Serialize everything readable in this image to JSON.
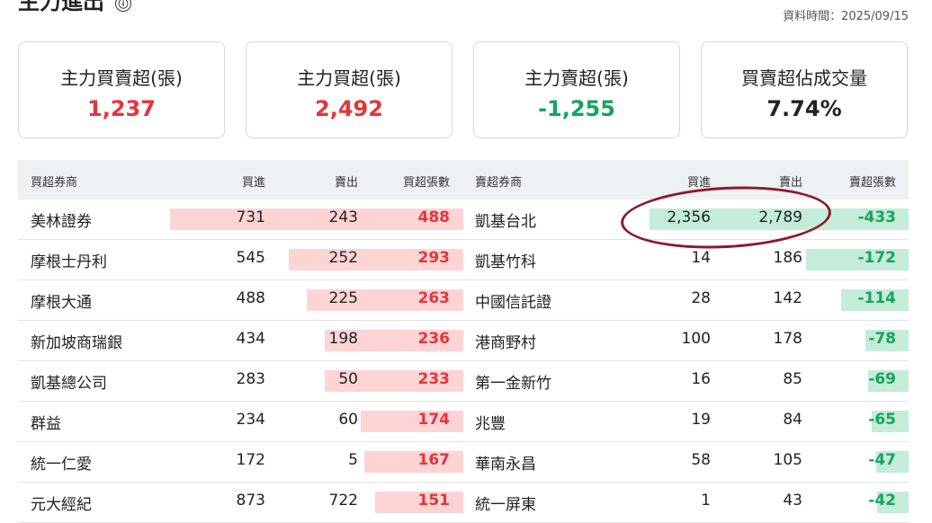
{
  "header": {
    "title": "主力進出",
    "info_icon": "ⓘ",
    "data_time": "資料時間：2025/09/15"
  },
  "cards": [
    {
      "title": "主力買賣超(張)",
      "value": "1,237",
      "color": "#e8333b"
    },
    {
      "title": "主力買超(張)",
      "value": "2,492",
      "color": "#e8333b"
    },
    {
      "title": "主力賣超(張)",
      "value": "-1,255",
      "color": "#15a45d"
    },
    {
      "title": "買賣超佔成交量",
      "value": "7.74%",
      "color": "#222222"
    }
  ],
  "table": {
    "buy_headers": {
      "broker": "買超券商",
      "buy": "買進",
      "sell": "賣出",
      "net": "買超張數"
    },
    "sell_headers": {
      "broker": "賣超券商",
      "buy": "買進",
      "sell": "賣出",
      "net": "賣超張數"
    },
    "buy_rows": [
      {
        "broker": "美林證券",
        "buy": "731",
        "sell": "243",
        "net": "488"
      },
      {
        "broker": "摩根士丹利",
        "buy": "545",
        "sell": "252",
        "net": "293"
      },
      {
        "broker": "摩根大通",
        "buy": "488",
        "sell": "225",
        "net": "263"
      },
      {
        "broker": "新加坡商瑞銀",
        "buy": "434",
        "sell": "198",
        "net": "236"
      },
      {
        "broker": "凱基總公司",
        "buy": "283",
        "sell": "50",
        "net": "233"
      },
      {
        "broker": "群益",
        "buy": "234",
        "sell": "60",
        "net": "174"
      },
      {
        "broker": "統一仁愛",
        "buy": "172",
        "sell": "5",
        "net": "167"
      },
      {
        "broker": "元大經紀",
        "buy": "873",
        "sell": "722",
        "net": "151"
      }
    ],
    "sell_rows": [
      {
        "broker": "凱基台北",
        "buy": "2,356",
        "sell": "2,789",
        "net": "-433"
      },
      {
        "broker": "凱基竹科",
        "buy": "14",
        "sell": "186",
        "net": "-172"
      },
      {
        "broker": "中國信託證",
        "buy": "28",
        "sell": "142",
        "net": "-114"
      },
      {
        "broker": "港商野村",
        "buy": "100",
        "sell": "178",
        "net": "-78"
      },
      {
        "broker": "第一金新竹",
        "buy": "16",
        "sell": "85",
        "net": "-69"
      },
      {
        "broker": "兆豐",
        "buy": "19",
        "sell": "84",
        "net": "-65"
      },
      {
        "broker": "華南永昌",
        "buy": "58",
        "sell": "105",
        "net": "-47"
      },
      {
        "broker": "統一屏東",
        "buy": "1",
        "sell": "43",
        "net": "-42"
      }
    ]
  }
}
